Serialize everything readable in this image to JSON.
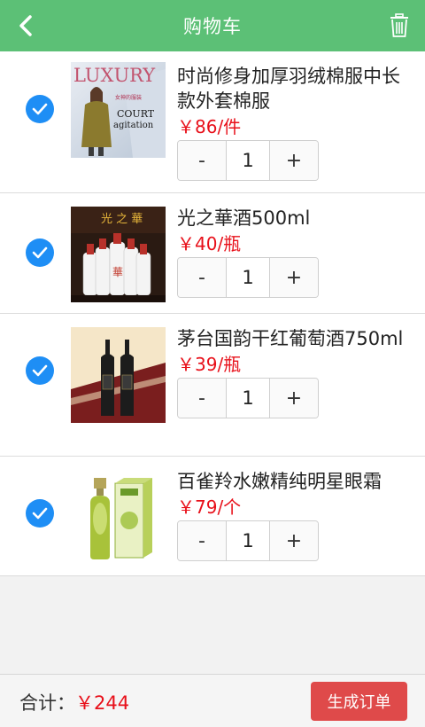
{
  "header": {
    "title": "购物车",
    "back_icon": "chevron-left-icon",
    "trash_icon": "trash-icon",
    "background": "#5cc076"
  },
  "cart": {
    "items": [
      {
        "name": "时尚修身加厚羽绒棉服中长款外套棉服",
        "price": "￥86/件",
        "quantity": "1",
        "minus_label": "-",
        "plus_label": "+",
        "checked": true,
        "image_text": {
          "headline": "LUXURY",
          "subline": "COURT",
          "subline2": "agitation",
          "tag": "女神的服装"
        }
      },
      {
        "name": "光之華酒500ml",
        "price": "￥40/瓶",
        "quantity": "1",
        "minus_label": "-",
        "plus_label": "+",
        "checked": true,
        "image_text": {
          "headline": "光 之 華",
          "bottle_label": "華"
        }
      },
      {
        "name": "茅台国韵干红葡萄酒750ml",
        "price": "￥39/瓶",
        "quantity": "1",
        "minus_label": "-",
        "plus_label": "+",
        "checked": true
      },
      {
        "name": "百雀羚水嫩精纯明星眼霜",
        "price": "￥79/个",
        "quantity": "1",
        "minus_label": "-",
        "plus_label": "+",
        "checked": true
      }
    ]
  },
  "footer": {
    "total_label": "合计：",
    "total_amount": "￥244",
    "order_button": "生成订单"
  },
  "colors": {
    "accent": "#5cc076",
    "check": "#1e8ef5",
    "price": "#e8101a",
    "order_button": "#df4a4a"
  }
}
